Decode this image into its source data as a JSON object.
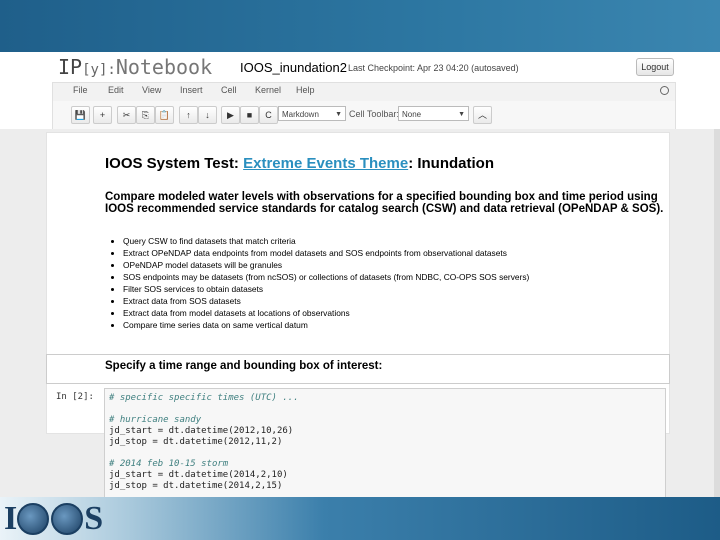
{
  "header": {
    "logo_prefix": "IP",
    "logo_y": "[y]:",
    "logo_suffix": "Notebook",
    "notebook_name": "IOOS_inundation2",
    "checkpoint": "Last Checkpoint: Apr 23 04:20 (autosaved)",
    "logout": "Logout"
  },
  "menu": [
    "File",
    "Edit",
    "View",
    "Insert",
    "Cell",
    "Kernel",
    "Help"
  ],
  "toolbar": {
    "buttons": [
      "💾",
      "+",
      "✂",
      "⎘",
      "📋",
      "↑",
      "↓",
      "▶",
      "■",
      "C"
    ],
    "cell_type": "Markdown",
    "cell_toolbar_label": "Cell Toolbar:",
    "cell_toolbar_value": "None",
    "collapse": "︿"
  },
  "markdown": {
    "title_prefix": "IOOS System Test:",
    "title_link": "Extreme Events Theme",
    "title_suffix": ": Inundation",
    "description": "Compare modeled water levels with observations for a specified bounding box and time period using IOOS recommended service standards for catalog search (CSW) and data retrieval (OPeNDAP & SOS).",
    "bullets": [
      "Query CSW to find datasets that match criteria",
      "Extract OPeNDAP data endpoints from model datasets and SOS endpoints from observational datasets",
      "OPeNDAP model datasets will be granules",
      "SOS endpoints may be datasets (from ncSOS) or collections of datasets (from NDBC, CO-OPS SOS servers)",
      "Filter SOS services to obtain datasets",
      "Extract data from SOS datasets",
      "Extract data from model datasets at locations of observations",
      "Compare time series data on same vertical datum"
    ],
    "subheading": "Specify a time range and bounding box of interest:"
  },
  "code_cell": {
    "prompt": "In [2]:",
    "lines": [
      "# specific specific times (UTC) ...",
      "",
      "# hurricane sandy",
      "jd_start = dt.datetime(2012,10,26)",
      "jd_stop = dt.datetime(2012,11,2)",
      "",
      "# 2014 feb 10-15 storm",
      "jd_start = dt.datetime(2014,2,10)",
      "jd_stop = dt.datetime(2014,2,15)"
    ]
  },
  "branding": {
    "logo": "IOOS"
  }
}
